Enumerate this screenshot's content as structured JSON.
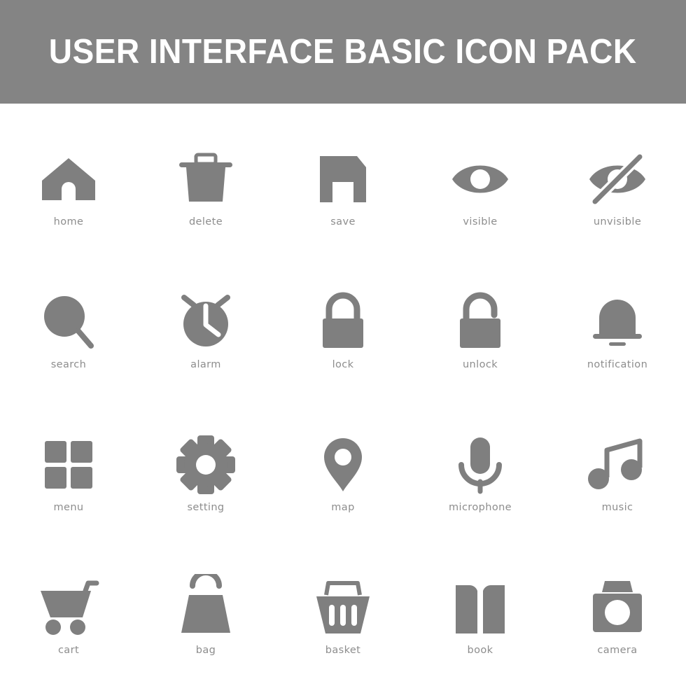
{
  "header": {
    "title": "USER INTERFACE BASIC ICON PACK",
    "background_color": "#848484",
    "text_color": "#ffffff"
  },
  "style": {
    "icon_color": "#7f7f7f",
    "label_color": "#8d8d8d",
    "page_background": "#ffffff"
  },
  "grid": {
    "columns": 5,
    "rows": 4,
    "icons": [
      {
        "label": "home",
        "icon": "home-icon"
      },
      {
        "label": "delete",
        "icon": "trash-icon"
      },
      {
        "label": "save",
        "icon": "floppy-disk-icon"
      },
      {
        "label": "visible",
        "icon": "eye-icon"
      },
      {
        "label": "unvisible",
        "icon": "eye-slash-icon"
      },
      {
        "label": "search",
        "icon": "magnifier-icon"
      },
      {
        "label": "alarm",
        "icon": "alarm-clock-icon"
      },
      {
        "label": "lock",
        "icon": "padlock-closed-icon"
      },
      {
        "label": "unlock",
        "icon": "padlock-open-icon"
      },
      {
        "label": "notification",
        "icon": "bell-icon"
      },
      {
        "label": "menu",
        "icon": "grid-squares-icon"
      },
      {
        "label": "setting",
        "icon": "gear-icon"
      },
      {
        "label": "map",
        "icon": "map-pin-icon"
      },
      {
        "label": "microphone",
        "icon": "microphone-icon"
      },
      {
        "label": "music",
        "icon": "music-note-icon"
      },
      {
        "label": "cart",
        "icon": "shopping-cart-icon"
      },
      {
        "label": "bag",
        "icon": "shopping-bag-icon"
      },
      {
        "label": "basket",
        "icon": "shopping-basket-icon"
      },
      {
        "label": "book",
        "icon": "open-book-icon"
      },
      {
        "label": "camera",
        "icon": "camera-icon"
      }
    ]
  }
}
